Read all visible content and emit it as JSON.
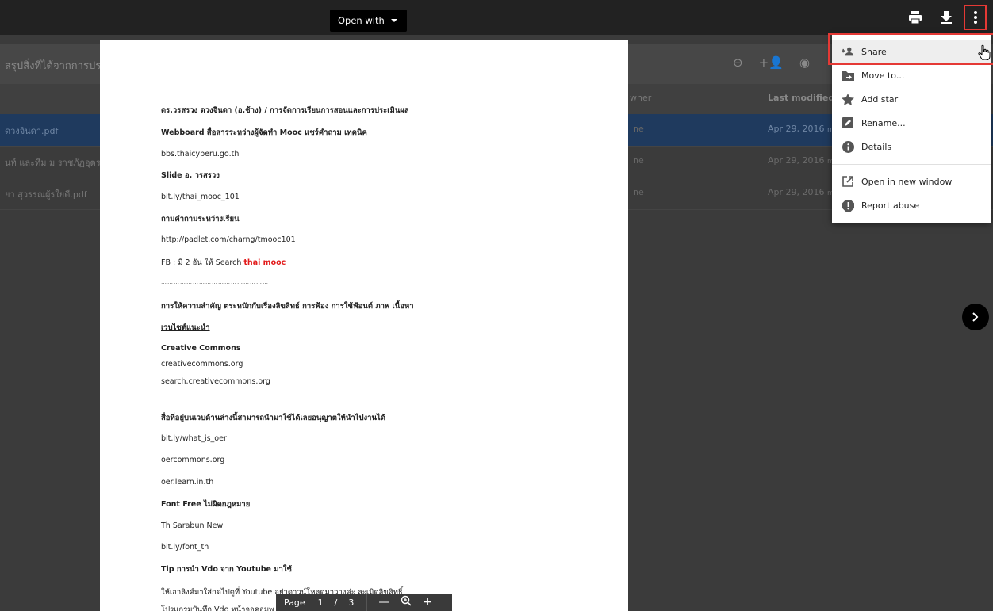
{
  "background": {
    "title": "สรุปสิ่งที่ได้จากการประ",
    "columns": {
      "owner": "wner",
      "last_modified": "Last modified"
    },
    "rows": [
      {
        "name": "ดวงจินดา.pdf",
        "owner": "ne",
        "modified": "Apr 29, 2016",
        "modified_suffix": "me"
      },
      {
        "name": "นท์ และทีม ม ราชภัฏอุตรดิ",
        "owner": "ne",
        "modified": "Apr 29, 2016",
        "modified_suffix": "me"
      },
      {
        "name": "ยา สุวรรณผู้รใยดี.pdf",
        "owner": "ne",
        "modified": "Apr 29, 2016",
        "modified_suffix": "me"
      }
    ]
  },
  "toolbar": {
    "open_with_label": "Open with",
    "print_icon": "print-icon",
    "download_icon": "download-icon",
    "more_icon": "more-vert-icon"
  },
  "document": {
    "lines": [
      "ดร.วรสรวง ดวงจินดา (อ.ช้าง) / การจัดการเรียนการสอนและการประเมินผล",
      "Webboard สื่อสารระหว่างผู้จัดทำ Mooc แชร์คำถาม เทคนิค",
      "bbs.thaicyberu.go.th",
      "Slide อ. วรสรวง",
      "bit.ly/thai_mooc_101",
      "ถามคำถามระหว่างเรียน",
      "http://padlet.com/charng/tmooc101",
      "FB : มี 2 อัน ให้ Search",
      "thai mooc",
      "……………………………………………",
      "การให้ความสำคัญ ตระหนักกับเรื่องลิขสิทธ์ การฟ้อง  การใช้ฟ้อนต์ ภาพ เนื้อหา",
      "เวบไซต์แนะนำ",
      "Creative Commons",
      "creativecommons.org",
      "search.creativecommons.org",
      "สื่อที่อยู่บนเวบด้านล่างนี้สามารถนำมาใช้ได้เลยอนุญาตให้นำไปงานได้",
      "bit.ly/what_is_oer",
      "oercommons.org",
      "oer.learn.in.th",
      "Font Free ไม่ผิดกฎหมาย",
      "Th Sarabun New",
      "bit.ly/font_th",
      "Tip การนำ Vdo จาก Youtube มาใช้",
      "ให้เอาลิงค์มาใส่กดไปดูที่  Youtube  อย่าดาวน์โหลดมาวางค่ะ ละเมิดลิขสิทธิ์",
      "โปรแกรมบันทึก Vdo หน้าจอคอมพ"
    ]
  },
  "pagenav": {
    "label": "Page",
    "current": "1",
    "separator": "/",
    "total": "3",
    "zoom_out": "—",
    "zoom_in": "+"
  },
  "menu": {
    "items": [
      {
        "label": "Share",
        "icon": "person-add-icon"
      },
      {
        "label": "Move to...",
        "icon": "folder-move-icon"
      },
      {
        "label": "Add star",
        "icon": "star-icon"
      },
      {
        "label": "Rename...",
        "icon": "edit-icon"
      },
      {
        "label": "Details",
        "icon": "info-icon"
      },
      {
        "label": "Open in new window",
        "icon": "open-in-new-icon"
      },
      {
        "label": "Report abuse",
        "icon": "report-icon"
      }
    ]
  },
  "colors": {
    "highlight": "#e53935",
    "accent_red": "#e21b1b",
    "selected_row": "#1f3a5e"
  }
}
